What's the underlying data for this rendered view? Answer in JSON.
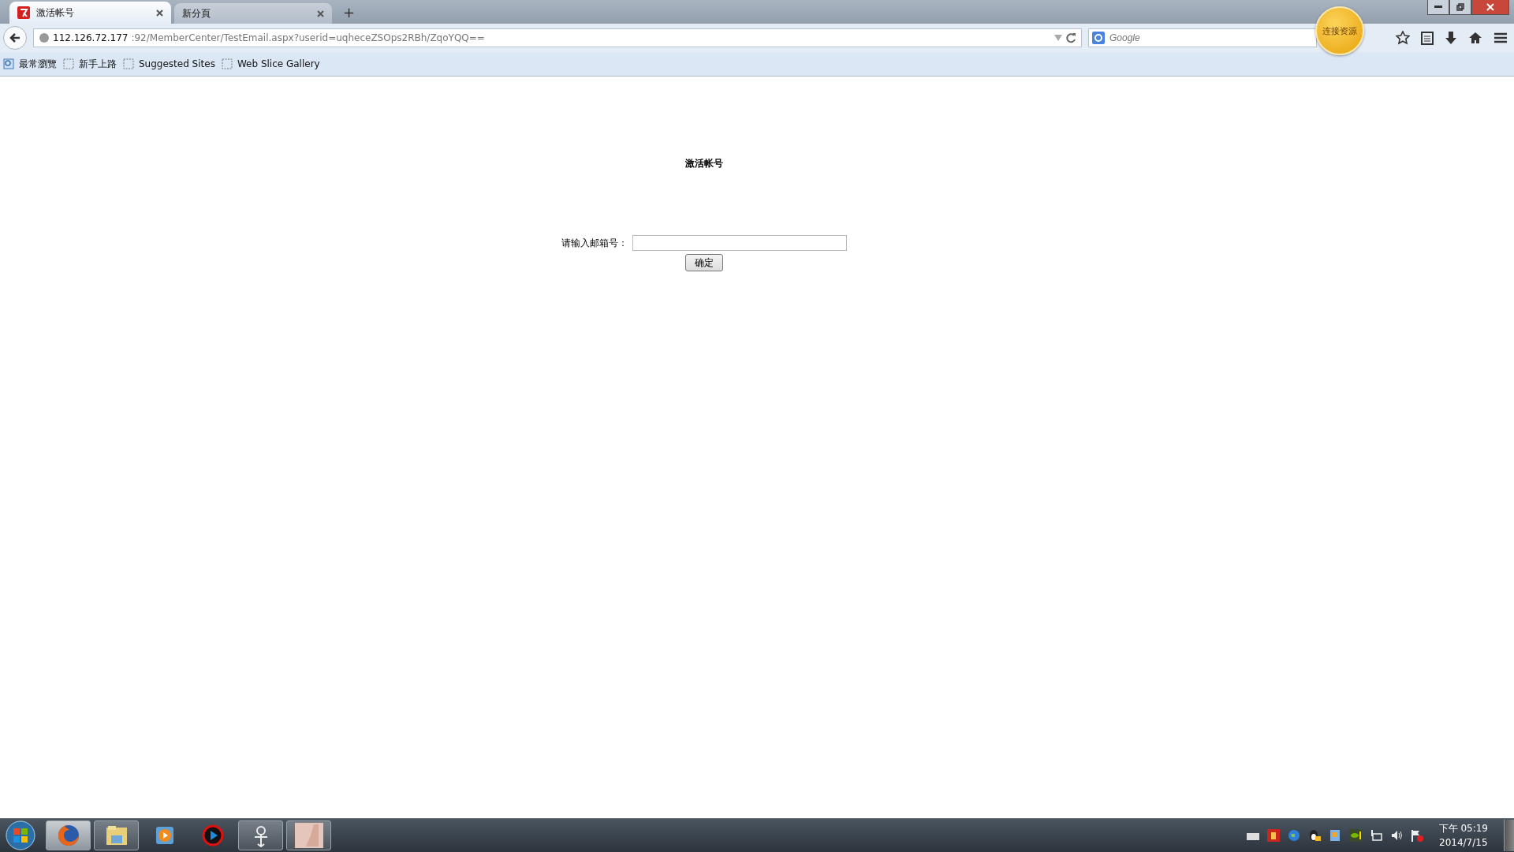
{
  "tabs": [
    {
      "label": "激活帐号",
      "selected": true,
      "kind": "site"
    },
    {
      "label": "新分頁",
      "selected": false,
      "kind": "blank"
    }
  ],
  "new_tab": "+",
  "address": {
    "host": "112.126.72.177",
    "rest": ":92/MemberCenter/TestEmail.aspx?userid=uqheceZSOps2RBh/ZqoYQQ=="
  },
  "search": {
    "placeholder": "Google"
  },
  "badge": "连接资源",
  "bookmarks": [
    {
      "label": "最常瀏覽",
      "kind": "special"
    },
    {
      "label": "新手上路",
      "kind": "folder"
    },
    {
      "label": "Suggested Sites",
      "kind": "folder"
    },
    {
      "label": "Web Slice Gallery",
      "kind": "folder"
    }
  ],
  "page": {
    "title": "激活帐号",
    "email_label": "请输入邮箱号：",
    "submit": "确定"
  },
  "taskbar": {
    "apps": [
      {
        "kind": "firefox",
        "running": true,
        "selected": true
      },
      {
        "kind": "folder",
        "running": true,
        "selected": false
      },
      {
        "kind": "media",
        "running": false,
        "selected": false
      },
      {
        "kind": "video",
        "running": false,
        "selected": false
      },
      {
        "kind": "symbol",
        "running": true,
        "selected": false
      },
      {
        "kind": "thumb",
        "running": true,
        "selected": false
      }
    ],
    "clock": {
      "time": "下午 05:19",
      "date": "2014/7/15"
    }
  }
}
